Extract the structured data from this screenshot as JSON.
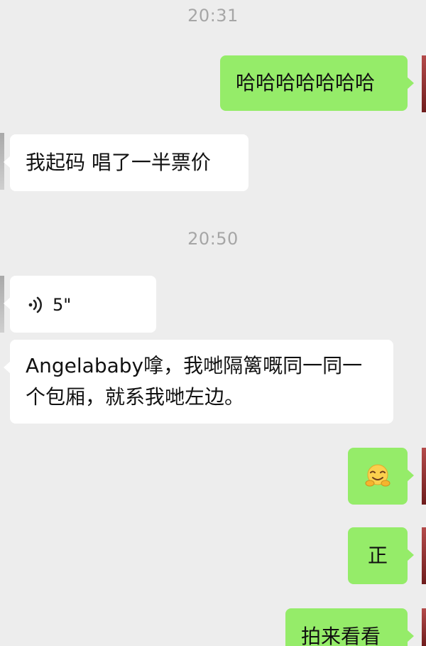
{
  "timestamps": [
    "20:31",
    "20:50"
  ],
  "messages": [
    {
      "direction": "outgoing",
      "type": "text",
      "text": "哈哈哈哈哈哈哈"
    },
    {
      "direction": "incoming",
      "type": "text",
      "text": "我起码 唱了一半票价"
    },
    {
      "direction": "incoming",
      "type": "voice",
      "duration": "5\""
    },
    {
      "direction": "incoming",
      "type": "text",
      "text": "Angelababy嗱，我哋隔篱嘅同一同一个包厢，就系我哋左边。"
    },
    {
      "direction": "outgoing",
      "type": "emoji",
      "emoji": "hugging-face-emoji"
    },
    {
      "direction": "outgoing",
      "type": "text",
      "text": "正"
    },
    {
      "direction": "outgoing",
      "type": "text",
      "text": "拍来看看"
    }
  ],
  "colors": {
    "background": "#ededed",
    "incoming_bubble": "#ffffff",
    "outgoing_bubble": "#95ec69",
    "timestamp_text": "#a6a6a6"
  }
}
